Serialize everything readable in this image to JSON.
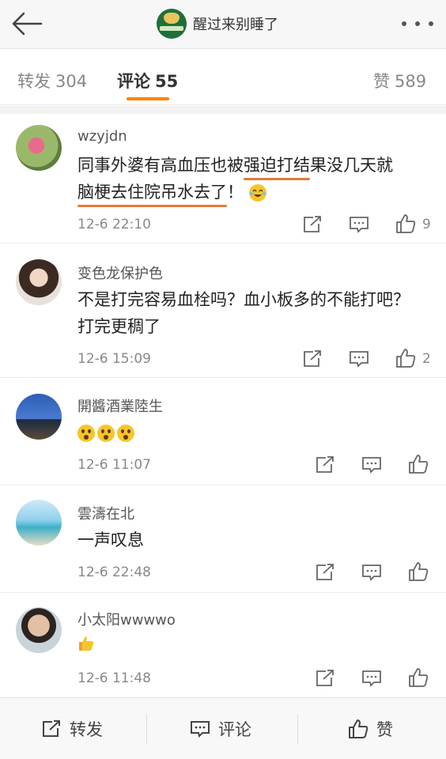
{
  "header": {
    "title": "醒过来别睡了",
    "back_icon": "arrow-left-icon",
    "more_icon": "more-dots-icon"
  },
  "tabs": [
    {
      "label": "转发",
      "count": "304"
    },
    {
      "label": "评论",
      "count": "55"
    },
    {
      "label": "赞",
      "count": "589"
    }
  ],
  "accent_color": "#ff8200",
  "comments": [
    {
      "user": "wzyjdn",
      "text_parts": [
        "同事外婆有高血压也",
        "被",
        "强迫打结",
        "果没几天就",
        "脑梗去住院吊水去了",
        "！"
      ],
      "emoji": "laughing-tears-emoji",
      "time": "12-6 22:10",
      "likes": "9"
    },
    {
      "user": "变色龙保护色",
      "text": "不是打完容易血栓吗？血小板多的不能打吧？打完更稠了",
      "time": "12-6 15:09",
      "likes": "2"
    },
    {
      "user": "開醬酒業陸生",
      "text": "",
      "emoji": "shocked-face-emoji x3",
      "time": "12-6 11:07",
      "likes": ""
    },
    {
      "user": "雲濤在北",
      "text": "一声叹息",
      "time": "12-6 22:48",
      "likes": ""
    },
    {
      "user": "小太阳wwwwo",
      "text": "",
      "emoji": "thumbs-up-emoji",
      "time": "12-6 11:48",
      "likes": ""
    }
  ],
  "bottom": {
    "repost": "转发",
    "comment": "评论",
    "like": "赞"
  }
}
